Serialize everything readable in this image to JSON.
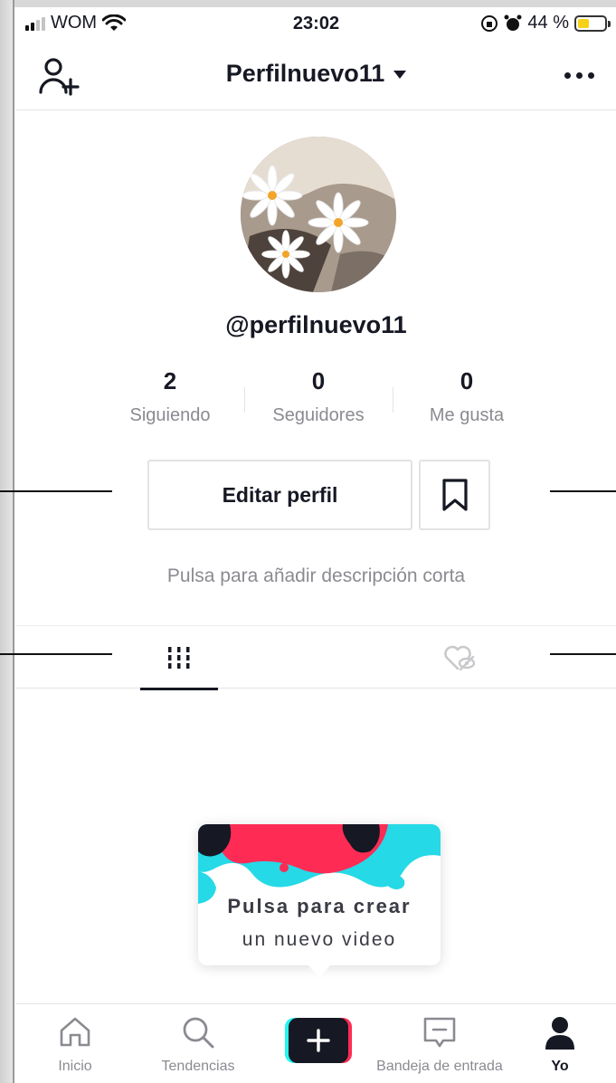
{
  "status_bar": {
    "carrier": "WOM",
    "time": "23:02",
    "battery_text": "44 %",
    "battery_level": 0.44,
    "battery_color": "#f7d117"
  },
  "header": {
    "title": "Perfilnuevo11",
    "left_icon": "add-user-icon",
    "right_icon": "more-icon"
  },
  "profile": {
    "username": "@perfilnuevo11",
    "stats": [
      {
        "value": "2",
        "label": "Siguiendo"
      },
      {
        "value": "0",
        "label": "Seguidores"
      },
      {
        "value": "0",
        "label": "Me gusta"
      }
    ],
    "edit_button": "Editar perfil",
    "bookmark_icon": "bookmark-icon",
    "bio_placeholder": "Pulsa para añadir descripción corta"
  },
  "tabs": {
    "videos_icon": "grid-icon",
    "liked_icon": "hidden-heart-icon",
    "active": "videos"
  },
  "create_card": {
    "title": "Pulsa para crear",
    "subtitle": "un nuevo video"
  },
  "bottom_nav": {
    "items": [
      {
        "label": "Inicio",
        "icon": "home-icon"
      },
      {
        "label": "Tendencias",
        "icon": "search-icon"
      },
      {
        "label": "",
        "icon": "plus-icon"
      },
      {
        "label": "Bandeja de entrada",
        "icon": "inbox-icon"
      },
      {
        "label": "Yo",
        "icon": "profile-icon"
      }
    ],
    "active": "Yo"
  },
  "colors": {
    "text_primary": "#161823",
    "text_secondary": "#8a8b91",
    "border": "#e3e3e4",
    "accent_red": "#fe2c55",
    "accent_cyan": "#25f4ee"
  }
}
